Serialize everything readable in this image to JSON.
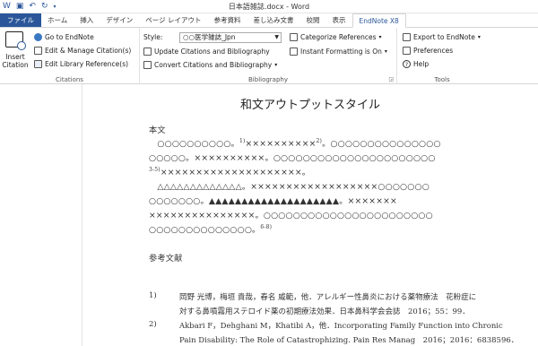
{
  "window": {
    "title": "日本語雑誌.docx - Word",
    "qat": {
      "save_icon": "💾",
      "undo": "↶",
      "redo": "↻"
    }
  },
  "tabs": [
    "ファイル",
    "ホーム",
    "挿入",
    "デザイン",
    "ページ レイアウト",
    "参考資料",
    "差し込み文書",
    "校閲",
    "表示",
    "EndNote X8"
  ],
  "ribbon": {
    "citations": {
      "insert_label_1": "Insert",
      "insert_label_2": "Citation",
      "go_to": "Go to EndNote",
      "edit_manage": "Edit & Manage Citation(s)",
      "edit_library": "Edit Library Reference(s)",
      "group_label": "Citations"
    },
    "bibliography": {
      "style_label": "Style:",
      "style_value": "○○医学雑誌_Jpn",
      "update": "Update Citations and Bibliography",
      "convert": "Convert Citations and Bibliography",
      "categorize": "Categorize References",
      "instant": "Instant Formatting is On",
      "group_label": "Bibliography"
    },
    "tools": {
      "export": "Export to EndNote",
      "preferences": "Preferences",
      "help": "Help",
      "group_label": "Tools"
    }
  },
  "document": {
    "heading": "和文アウトプットスタイル",
    "body_label": "本文",
    "lines": [
      {
        "pre": "　○○○○○○○○○○。",
        "cite": "1)",
        "post": "××××××××××",
        "cite2": "2)",
        "post2": "。○○○○○○○○○○○○○○○"
      },
      {
        "pre": "○○○○○。××××××××××。○○○○○○○○○○○○○○○○○○○○○○",
        "cite": "",
        "post": "",
        "cite2": "",
        "post2": ""
      },
      {
        "pre": "",
        "cite": "3-5)",
        "post": "××××××××××××××××××××。",
        "cite2": "",
        "post2": ""
      },
      {
        "pre": "　△△△△△△△△△△△△△。××××××××××××××××××○○○○○○○",
        "cite": "",
        "post": "",
        "cite2": "",
        "post2": ""
      },
      {
        "pre": "○○○○○○○。▲▲▲▲▲▲▲▲▲▲▲▲▲▲▲▲▲▲▲▲。×××××××",
        "cite": "",
        "post": "",
        "cite2": "",
        "post2": ""
      },
      {
        "pre": "×××××××××××××××。○○○○○○○○○○○○○○○○○○○○○○○",
        "cite": "",
        "post": "",
        "cite2": "",
        "post2": ""
      },
      {
        "pre": "○○○○○○○○○○○○○○。",
        "cite": "6-8)",
        "post": "",
        "cite2": "",
        "post2": ""
      }
    ],
    "refs_label": "参考文献",
    "references": [
      {
        "num": "1)",
        "line1": "岡野 光博，梅垣 貴哉，春名 威範，他．アレルギー性鼻炎における薬物療法　花粉症に",
        "line2": "対する鼻噴霧用ステロイド薬の初期療法効果．日本鼻科学会会誌　2016；55：99．"
      },
      {
        "num": "2)",
        "line1": "Akbari F，Dehghani M，Khatibi A，他．Incorporating Family Function into Chronic",
        "line2": "Pain Disability: The Role of Catastrophizing. Pain Res Manag　2016；2016：6838596．"
      }
    ]
  }
}
